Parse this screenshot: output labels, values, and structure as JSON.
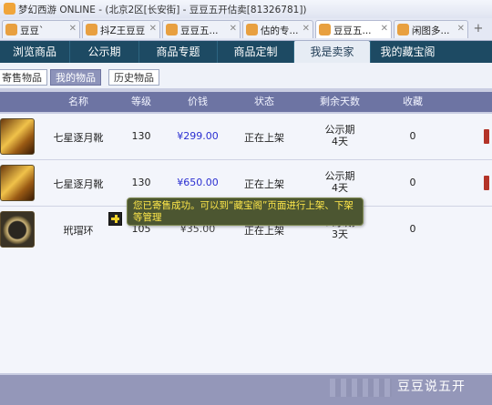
{
  "window": {
    "title": "梦幻西游 ONLINE - (北京2区[长安街] - 豆豆五开估卖[81326781])"
  },
  "browser_tabs": [
    {
      "label": "豆豆`"
    },
    {
      "label": "抖Z王豆豆"
    },
    {
      "label": "豆豆五..."
    },
    {
      "label": "估的专..."
    },
    {
      "label": "豆豆五..."
    },
    {
      "label": "闲图多..."
    }
  ],
  "nav": {
    "items": [
      {
        "label": "浏览商品"
      },
      {
        "label": "公示期"
      },
      {
        "label": "商品专题"
      },
      {
        "label": "商品定制"
      },
      {
        "label": "我是卖家"
      },
      {
        "label": "我的藏宝阁"
      }
    ]
  },
  "subtabs": [
    {
      "label": "寄售物品"
    },
    {
      "label": "我的物品"
    },
    {
      "label": "历史物品"
    }
  ],
  "table": {
    "headers": {
      "name": "名称",
      "level": "等级",
      "price": "价钱",
      "status": "状态",
      "remaining": "剩余天数",
      "favorite": "收藏"
    },
    "rows": [
      {
        "icon": "boots-item-icon",
        "name": "七星逐月靴",
        "level": "130",
        "price": "¥299.00",
        "status": "正在上架",
        "remaining": "公示期\n4天",
        "favorite": "0"
      },
      {
        "icon": "boots-item-icon",
        "name": "七星逐月靴",
        "level": "130",
        "price": "¥650.00",
        "status": "正在上架",
        "remaining": "公示期\n4天",
        "favorite": "0"
      },
      {
        "icon": "ring-item-icon",
        "name": "玳瑁环",
        "level": "105",
        "price": "¥35.00",
        "status": "正在上架",
        "remaining": "公示期\n3天",
        "favorite": "0"
      }
    ]
  },
  "tooltip": {
    "text": "您已寄售成功。可以到“藏宝阁”页面进行上架、下架等管理"
  },
  "watermark": {
    "text": "豆豆说五开"
  },
  "colors": {
    "navbar": "#1d4a63",
    "table_header": "#6d74a3",
    "price": "#2b2fd1",
    "tooltip_bg": "#4c5631",
    "tooltip_text": "#ffe84a"
  }
}
